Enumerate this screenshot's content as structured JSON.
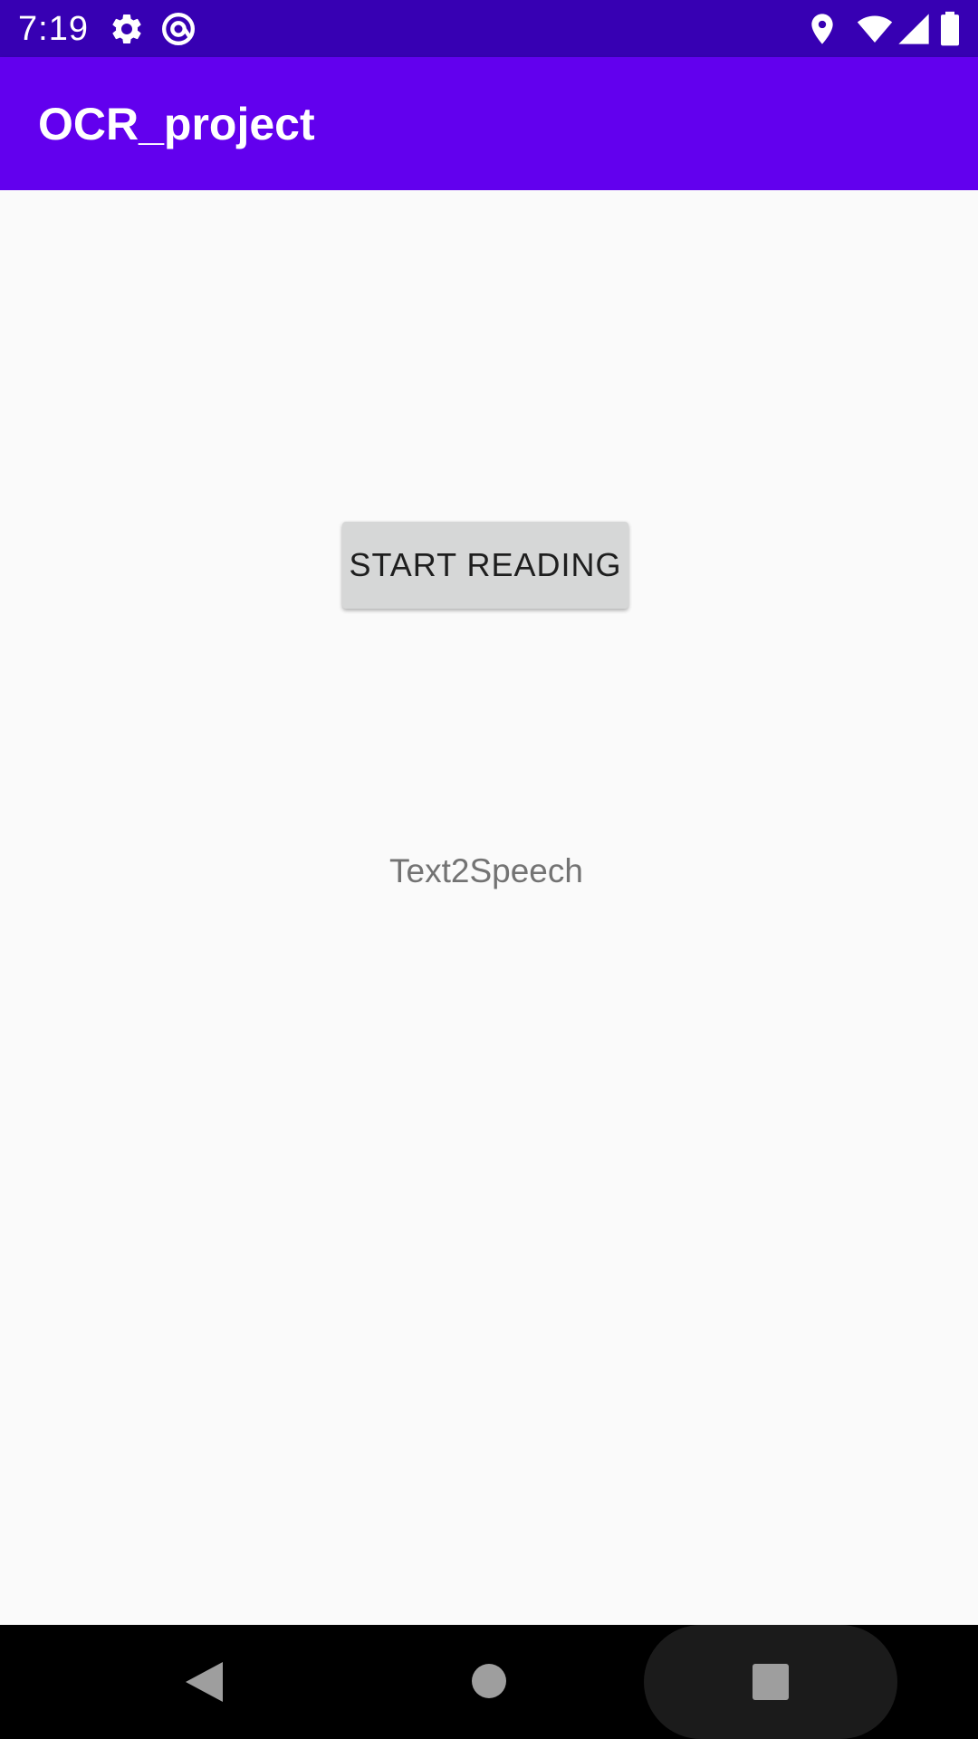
{
  "status_bar": {
    "time": "7:19",
    "icons": [
      "settings-gear-icon",
      "at-sign-icon",
      "location-pin-icon",
      "wifi-icon",
      "cell-signal-icon",
      "battery-icon"
    ],
    "background": "#3700b3"
  },
  "app_bar": {
    "title": "OCR_project",
    "background": "#6200ee"
  },
  "main": {
    "start_button_label": "START READING",
    "label_text": "Text2Speech"
  },
  "nav_bar": {
    "icons": [
      "back-triangle-icon",
      "home-circle-icon",
      "recents-square-icon"
    ]
  }
}
